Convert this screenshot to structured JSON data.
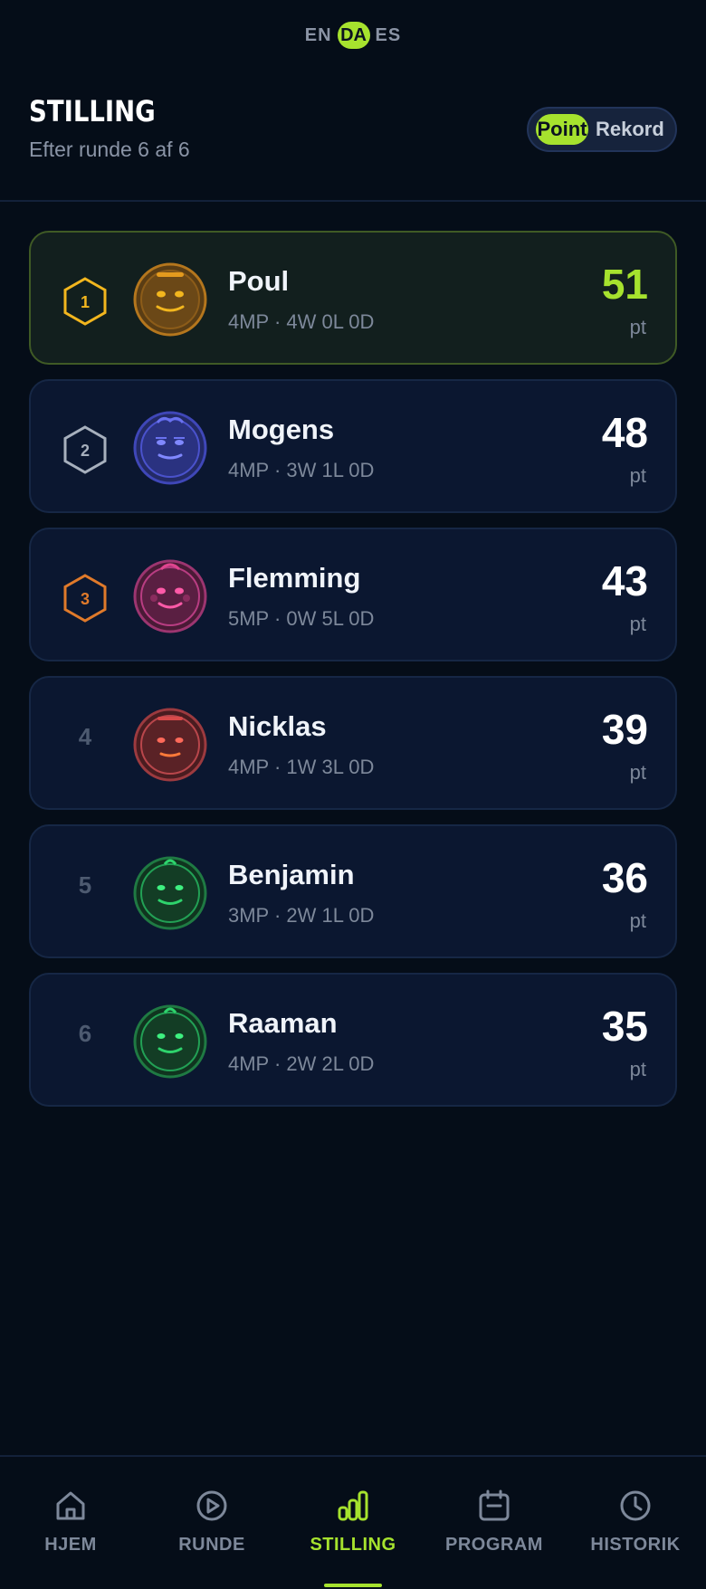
{
  "languages": [
    {
      "code": "EN",
      "active": false
    },
    {
      "code": "DA",
      "active": true
    },
    {
      "code": "ES",
      "active": false
    }
  ],
  "header": {
    "title": "STILLING",
    "subtitle": "Efter runde 6 af 6",
    "toggle": {
      "selected": "Point",
      "other": "Rekord"
    }
  },
  "standings": [
    {
      "rank": "1",
      "name": "Poul",
      "stats": "4MP · 4W 0L 0D",
      "score": "51",
      "unit": "pt",
      "color": "#e39a1e"
    },
    {
      "rank": "2",
      "name": "Mogens",
      "stats": "4MP · 3W 1L 0D",
      "score": "48",
      "unit": "pt",
      "color": "#5b63e6"
    },
    {
      "rank": "3",
      "name": "Flemming",
      "stats": "5MP · 0W 5L 0D",
      "score": "43",
      "unit": "pt",
      "color": "#e0458f"
    },
    {
      "rank": "4",
      "name": "Nicklas",
      "stats": "4MP · 1W 3L 0D",
      "score": "39",
      "unit": "pt",
      "color": "#d84a4a"
    },
    {
      "rank": "5",
      "name": "Benjamin",
      "stats": "3MP · 2W 1L 0D",
      "score": "36",
      "unit": "pt",
      "color": "#22c55e"
    },
    {
      "rank": "6",
      "name": "Raaman",
      "stats": "4MP · 2W 2L 0D",
      "score": "35",
      "unit": "pt",
      "color": "#22c55e"
    }
  ],
  "nav": [
    {
      "label": "HJEM",
      "icon": "home-icon",
      "active": false
    },
    {
      "label": "RUNDE",
      "icon": "play-circle-icon",
      "active": false
    },
    {
      "label": "STILLING",
      "icon": "bar-chart-icon",
      "active": true
    },
    {
      "label": "PROGRAM",
      "icon": "calendar-icon",
      "active": false
    },
    {
      "label": "HISTORIK",
      "icon": "clock-icon",
      "active": false
    }
  ],
  "colors": {
    "accent": "#a6e22e",
    "gold": "#f2b61e",
    "silver": "#a7b0bd",
    "bronze": "#e07a2a"
  }
}
